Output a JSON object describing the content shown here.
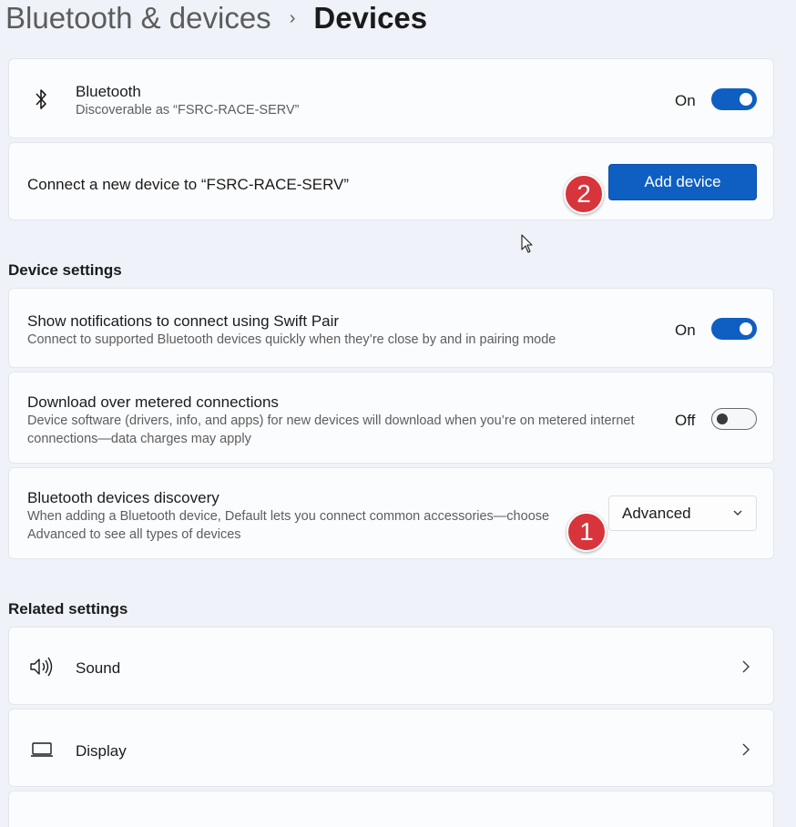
{
  "breadcrumb": {
    "parent": "Bluetooth & devices",
    "separator": "›",
    "current": "Devices"
  },
  "bluetooth": {
    "title": "Bluetooth",
    "subtitle": "Discoverable as “FSRC-RACE-SERV”",
    "state": "On",
    "icon": "bluetooth-icon"
  },
  "connect": {
    "text": "Connect a new device to “FSRC-RACE-SERV”",
    "button": "Add device"
  },
  "badges": {
    "first": "1",
    "second": "2"
  },
  "device_settings": {
    "heading": "Device settings",
    "swift_pair": {
      "title": "Show notifications to connect using Swift Pair",
      "subtitle": "Connect to supported Bluetooth devices quickly when they’re close by and in pairing mode",
      "state": "On"
    },
    "metered": {
      "title": "Download over metered connections",
      "subtitle": "Device software (drivers, info, and apps) for new devices will download when you’re on metered internet connections—data charges may apply",
      "state": "Off"
    },
    "discovery": {
      "title": "Bluetooth devices discovery",
      "subtitle": "When adding a Bluetooth device, Default lets you connect common accessories—choose Advanced to see all types of devices",
      "selected": "Advanced"
    }
  },
  "related_settings": {
    "heading": "Related settings",
    "items": [
      {
        "label": "Sound",
        "icon": "speaker-icon"
      },
      {
        "label": "Display",
        "icon": "laptop-icon"
      }
    ]
  },
  "colors": {
    "accent": "#0f5fc2",
    "badge": "#d8343c",
    "background": "#eff3f9"
  }
}
